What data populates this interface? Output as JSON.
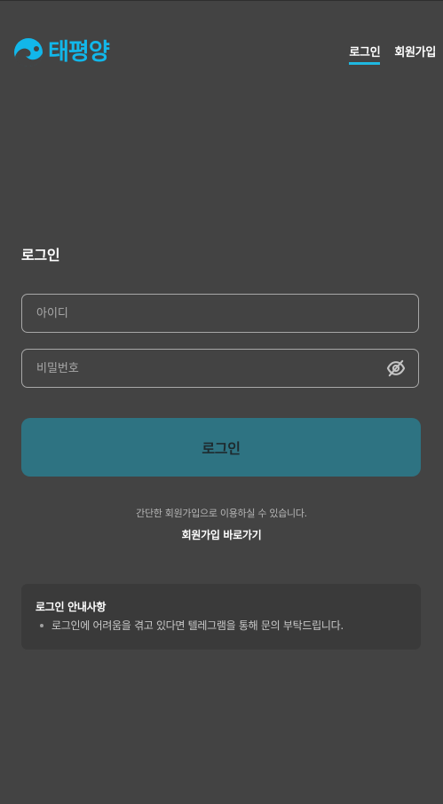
{
  "header": {
    "logo_text": "태평양",
    "nav": [
      {
        "label": "로그인",
        "active": true
      },
      {
        "label": "회원가입",
        "active": false
      }
    ]
  },
  "login": {
    "title": "로그인",
    "id_placeholder": "아이디",
    "password_placeholder": "비밀번호",
    "submit_label": "로그인",
    "signup_hint": "간단한 회원가입으로 이용하실 수 있습니다.",
    "signup_link": "회원가입 바로가기"
  },
  "notice": {
    "title": "로그인 안내사항",
    "items": [
      "로그인에 어려움을 겪고 있다면 텔레그램을 통해 문의 부탁드립니다."
    ]
  },
  "colors": {
    "background": "#434343",
    "accent": "#12b7ea",
    "button": "#2e7382"
  }
}
